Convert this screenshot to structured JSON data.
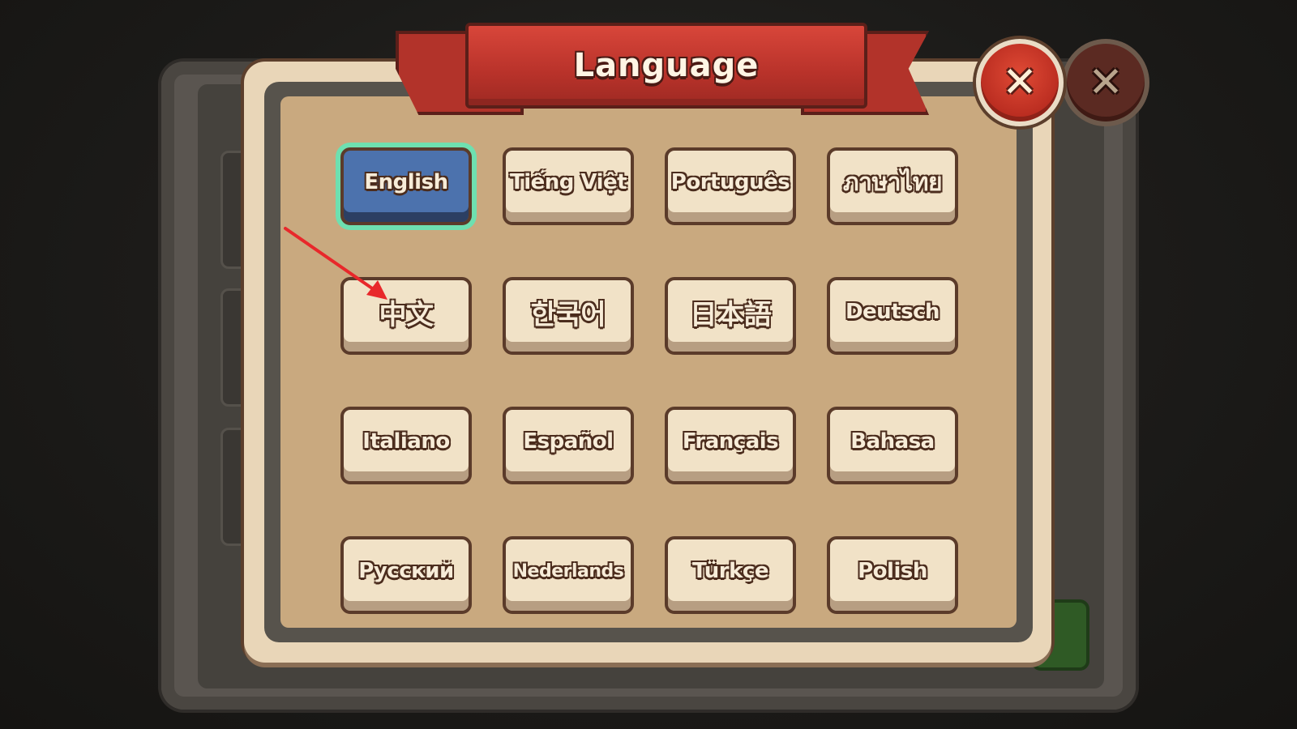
{
  "dialog": {
    "title": "Language",
    "close_symbol": "✕"
  },
  "background": {
    "close_symbol": "✕"
  },
  "languages": [
    {
      "label": "English",
      "selected": true
    },
    {
      "label": "Tiếng Việt",
      "selected": false
    },
    {
      "label": "Português",
      "selected": false
    },
    {
      "label": "ภาษาไทย",
      "selected": false
    },
    {
      "label": "中文",
      "selected": false
    },
    {
      "label": "한국어",
      "selected": false
    },
    {
      "label": "日本語",
      "selected": false
    },
    {
      "label": "Deutsch",
      "selected": false
    },
    {
      "label": "Italiano",
      "selected": false
    },
    {
      "label": "Español",
      "selected": false
    },
    {
      "label": "Français",
      "selected": false
    },
    {
      "label": "Bahasa",
      "selected": false
    },
    {
      "label": "Русский",
      "selected": false
    },
    {
      "label": "Nederlands",
      "selected": false
    },
    {
      "label": "Türkçe",
      "selected": false
    },
    {
      "label": "Polish",
      "selected": false
    }
  ],
  "colors": {
    "selected_button": "#4c72ad",
    "selected_glow": "#6ee0b0",
    "ribbon": "#c43a2f",
    "close_button": "#d2402f",
    "annotation_arrow": "#e8282b"
  }
}
